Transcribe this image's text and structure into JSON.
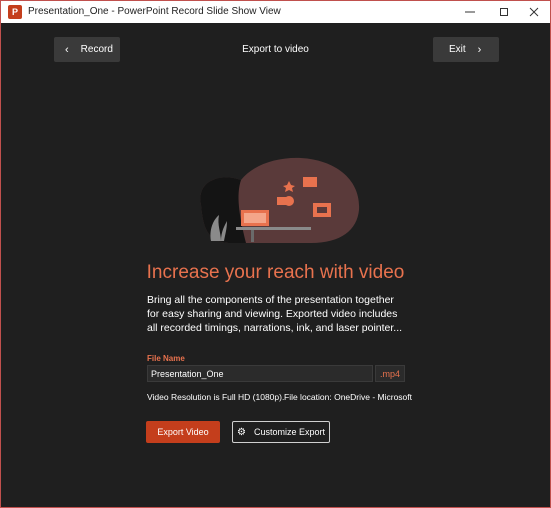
{
  "window": {
    "title": "Presentation_One - PowerPoint Record Slide Show View",
    "app_icon_letter": "P"
  },
  "header": {
    "back_label": "Record",
    "title": "Export to video",
    "exit_label": "Exit"
  },
  "main": {
    "headline": "Increase your reach with video",
    "description": "Bring all the components of the presentation together for easy sharing and viewing. Exported video includes all recorded timings, narrations, ink, and laser pointer...",
    "file_name_label": "File Name",
    "file_name_value": "Presentation_One",
    "file_extension": ".mp4",
    "resolution_text": "Video Resolution is Full HD (1080p).",
    "location_text": "File location: OneDrive - Microsoft",
    "export_button": "Export Video",
    "customize_button": "Customize Export"
  },
  "icons": {
    "back": "chevron-left-icon",
    "forward": "chevron-right-icon",
    "settings": "gear-icon",
    "app": "powerpoint-icon"
  },
  "colors": {
    "accent": "#c43e1c",
    "accent_text": "#e8724e",
    "background": "#1f1f1f",
    "button_bg": "#3a3a3a"
  }
}
